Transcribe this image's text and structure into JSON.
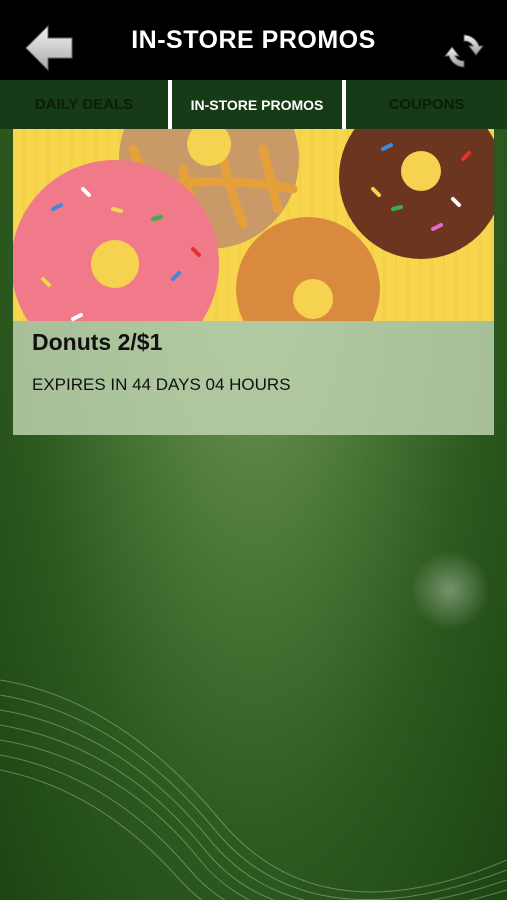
{
  "header": {
    "title": "IN-STORE PROMOS",
    "back_icon": "back-arrow-icon",
    "refresh_icon": "refresh-icon"
  },
  "tabs": [
    {
      "label": "DAILY DEALS",
      "active": false
    },
    {
      "label": "IN-STORE PROMOS",
      "active": true
    },
    {
      "label": "COUPONS",
      "active": false
    }
  ],
  "promos": [
    {
      "title": "Donuts 2/$1",
      "expiry": "EXPIRES IN 44 DAYS 04 HOURS"
    }
  ],
  "colors": {
    "header_bg": "#000000",
    "tab_bg": "#173b16",
    "card_info_bg": "#bed2af"
  }
}
